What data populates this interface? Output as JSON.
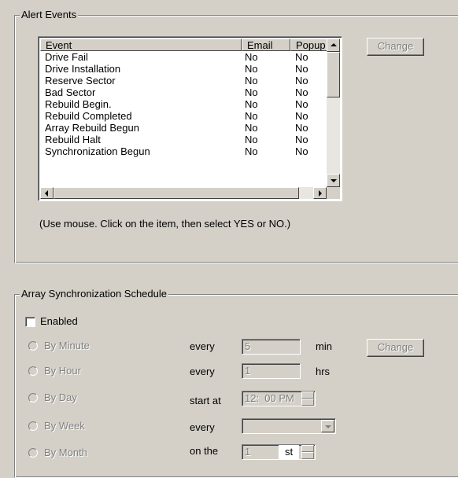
{
  "alert_events": {
    "title": "Alert Events",
    "columns": [
      "Event",
      "Email",
      "Popup"
    ],
    "rows": [
      {
        "event": "Drive Fail",
        "email": "No",
        "popup": "No"
      },
      {
        "event": "Drive Installation",
        "email": "No",
        "popup": "No"
      },
      {
        "event": "Reserve Sector",
        "email": "No",
        "popup": "No"
      },
      {
        "event": "Bad Sector",
        "email": "No",
        "popup": "No"
      },
      {
        "event": "Rebuild Begin.",
        "email": "No",
        "popup": "No"
      },
      {
        "event": "Rebuild Completed",
        "email": "No",
        "popup": "No"
      },
      {
        "event": "Array Rebuild Begun",
        "email": "No",
        "popup": "No"
      },
      {
        "event": "Rebuild Halt",
        "email": "No",
        "popup": "No"
      },
      {
        "event": "Synchronization Begun",
        "email": "No",
        "popup": "No"
      }
    ],
    "change_label": "Change",
    "hint": "(Use mouse. Click on the item, then select YES or NO.)"
  },
  "sync_schedule": {
    "title": "Array Synchronization Schedule",
    "enabled_label": "Enabled",
    "enabled_checked": false,
    "options": [
      {
        "label": "By Minute",
        "prefix": "every",
        "value": "5",
        "unit": "min"
      },
      {
        "label": "By Hour",
        "prefix": "every",
        "value": "1",
        "unit": "hrs"
      },
      {
        "label": "By Day",
        "prefix": "start at",
        "value": "12:  00 PM",
        "unit": ""
      },
      {
        "label": "By Week",
        "prefix": "every",
        "value": "",
        "unit": ""
      },
      {
        "label": "By Month",
        "prefix": "on the",
        "value": "1",
        "suffix": "st",
        "unit": ""
      }
    ],
    "change_label": "Change"
  },
  "colors": {
    "face": "#d4d0c8",
    "disabled": "#808080",
    "highlight": "#ffffff",
    "shadow": "#404040"
  }
}
